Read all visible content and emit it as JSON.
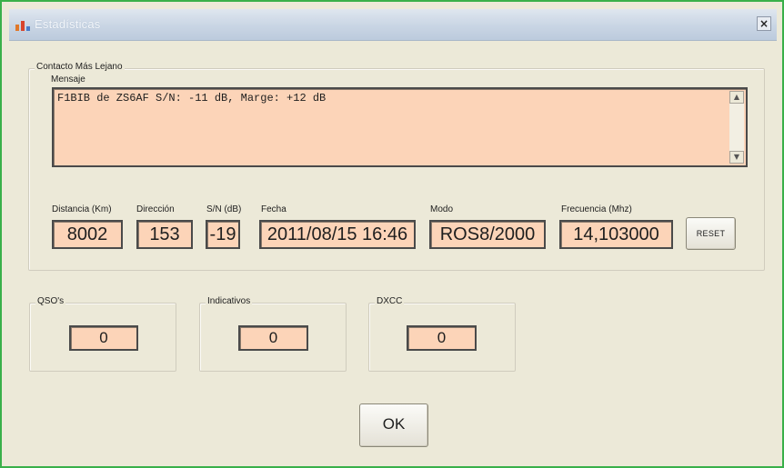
{
  "window": {
    "title": "Estadísticas",
    "close_label": "×"
  },
  "farthest_contact": {
    "group_label": "Contacto Más Lejano",
    "message": {
      "label": "Mensaje",
      "value": "F1BIB de ZS6AF S/N: -11 dB, Marge: +12 dB"
    },
    "fields": {
      "distance": {
        "label": "Distancia (Km)",
        "value": "8002"
      },
      "direction": {
        "label": "Dirección",
        "value": "153"
      },
      "snr": {
        "label": "S/N (dB)",
        "value": "-19"
      },
      "date": {
        "label": "Fecha",
        "value": "2011/08/15 16:46"
      },
      "mode": {
        "label": "Modo",
        "value": "ROS8/2000"
      },
      "frequency": {
        "label": "Frecuencia (Mhz)",
        "value": "14,103000"
      }
    },
    "reset_label": "RESET"
  },
  "counters": {
    "qsos": {
      "label": "QSO's",
      "value": "0"
    },
    "callsigns": {
      "label": "Indicativos",
      "value": "0"
    },
    "dxcc": {
      "label": "DXCC",
      "value": "0"
    }
  },
  "ok_label": "OK"
}
